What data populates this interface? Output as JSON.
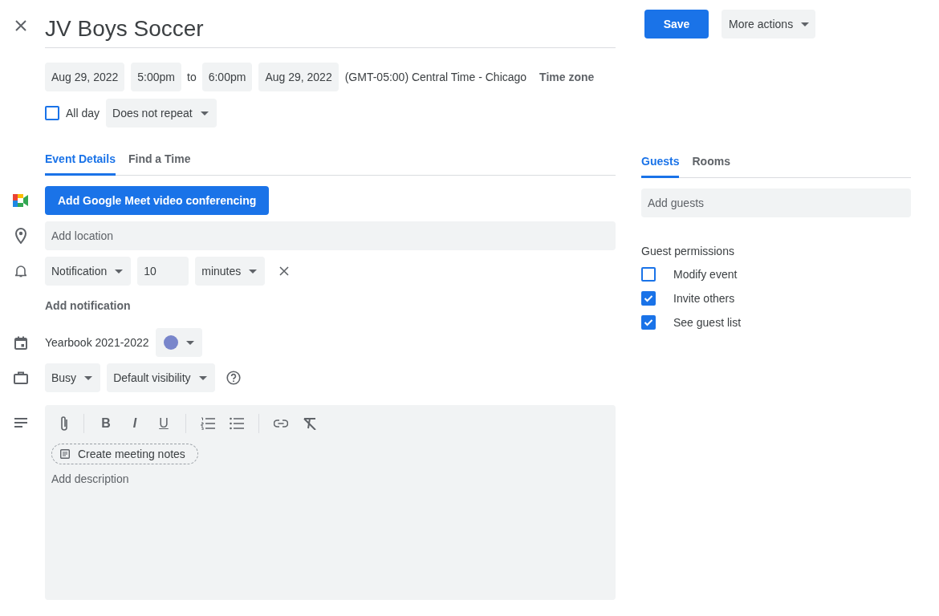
{
  "title": "JV Boys Soccer",
  "save": "Save",
  "more_actions": "More actions",
  "schedule": {
    "start_date": "Aug 29, 2022",
    "start_time": "5:00pm",
    "to": "to",
    "end_time": "6:00pm",
    "end_date": "Aug 29, 2022",
    "timezone": "(GMT-05:00) Central Time - Chicago",
    "timezone_button": "Time zone"
  },
  "all_day": {
    "label": "All day",
    "checked": false
  },
  "repeat": "Does not repeat",
  "tabs": [
    {
      "label": "Event Details",
      "selected": true
    },
    {
      "label": "Find a Time",
      "selected": false
    }
  ],
  "meet_button": "Add Google Meet video conferencing",
  "location": {
    "placeholder": "Add location"
  },
  "notification": {
    "type": "Notification",
    "value": "10",
    "unit": "minutes"
  },
  "add_notification": "Add notification",
  "calendar": {
    "name": "Yearbook 2021-2022",
    "color": "#7986cb"
  },
  "availability": "Busy",
  "visibility": "Default visibility",
  "format_buttons": [
    "B",
    "I",
    "U"
  ],
  "description": {
    "meeting_notes": "Create meeting notes",
    "placeholder": "Add description"
  },
  "guest_tabs": [
    {
      "label": "Guests",
      "selected": true
    },
    {
      "label": "Rooms",
      "selected": false
    }
  ],
  "guests": {
    "placeholder": "Add guests"
  },
  "permissions": {
    "title": "Guest permissions",
    "items": [
      {
        "label": "Modify event",
        "checked": false
      },
      {
        "label": "Invite others",
        "checked": true
      },
      {
        "label": "See guest list",
        "checked": true
      }
    ]
  }
}
